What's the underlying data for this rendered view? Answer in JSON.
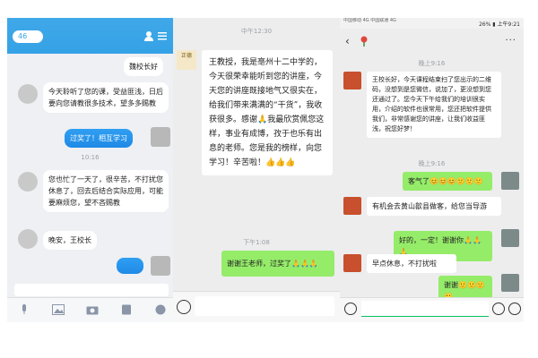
{
  "panel1": {
    "back_label": "46",
    "title": "",
    "messages": [
      "魏校长好",
      "今天聆听了您的课，受益匪浅，日后要向您请教很多技术，望多多赐教",
      "过奖了！相互学习",
      "10:16",
      "您也忙了一天了，很辛苦，不打扰您休息了，回去后结合实际应用，可能要麻烦您，望不吝赐教",
      "晚安，王校长"
    ]
  },
  "panel2": {
    "time1": "中午12:30",
    "logo": "正德",
    "message_long": "王教授，我是亳州十二中学的，今天很荣幸能听到您的讲座，今天您的讲座既接地气又很实在，给我们带来满满的“干货”，我收获很多。感谢🙏我最欣赏佩您这样，事业有成博，孜于也乐有出息的老师。您是我的榜样，向您学习！辛苦啦！👍👍👍",
    "time2": "下午1:08",
    "reply": "谢谢王老师，过奖了🙏🙏🙏"
  },
  "panel3": {
    "status_left": "中国移动 4G\n中国联通 4G",
    "status_right": "26% ▮ 上午9:21",
    "time1": "晚上9:16",
    "msg1": "王校长好，今天课程结束扫了您出示的二维码，没想到是您微信，说加了，更没想到您还通过了。您今天下午给我们的培训很实用，介绍的软件也很常用，您还把软件提供我们，非常感谢您的讲座，让我们收益匪浅，祝您好梦！",
    "time2": "晚上9:16",
    "reply1": "客气了😊😊😊🙂🙂🙂",
    "msg2": "有机会去黄山歙县做客，给您当导游",
    "reply2": "好的，一定！谢谢你🙏🙏🙏",
    "msg3": "早点休息，不打扰啦",
    "reply3": "谢谢🙂🙂🙂🙂"
  },
  "colors": {
    "qq_blue": "#35a2e6",
    "wechat_green": "#95ec69",
    "wechat_bg": "#ededed"
  }
}
